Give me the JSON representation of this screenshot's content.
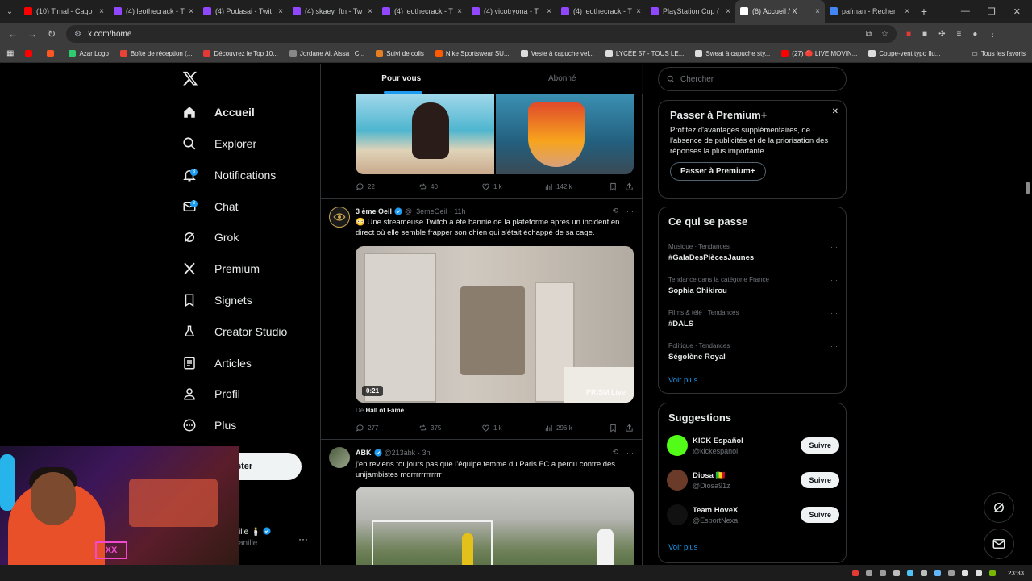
{
  "browser": {
    "tabs": [
      {
        "title": "(10) Timal - Cago",
        "color": "#ff0000"
      },
      {
        "title": "(4) leothecrack - T",
        "color": "#9146ff"
      },
      {
        "title": "(4) Podasai - Twit",
        "color": "#9146ff"
      },
      {
        "title": "(4) skaey_ftn - Tw",
        "color": "#9146ff"
      },
      {
        "title": "(4) leothecrack - T",
        "color": "#9146ff"
      },
      {
        "title": "(4) vicotryona - T",
        "color": "#9146ff"
      },
      {
        "title": "(4) leothecrack - T",
        "color": "#9146ff"
      },
      {
        "title": "PlayStation Cup (",
        "color": "#9146ff"
      },
      {
        "title": "(6) Accueil / X",
        "color": "#ffffff",
        "active": true
      },
      {
        "title": "pafman - Recher",
        "color": "#4285f4"
      }
    ],
    "url": "x.com/home",
    "bookmarks": [
      {
        "label": "",
        "color": "#ff0000"
      },
      {
        "label": "",
        "color": "#ff5722"
      },
      {
        "label": "Azar Logo",
        "color": "#2ecc71"
      },
      {
        "label": "Boîte de réception (...",
        "color": "#ea4335"
      },
      {
        "label": "Découvrez le Top 10...",
        "color": "#e53935"
      },
      {
        "label": "Jordane Ait Aissa | C...",
        "color": "#888888"
      },
      {
        "label": "Suivi de colis",
        "color": "#e67e22"
      },
      {
        "label": "Nike Sportswear SU...",
        "color": "#ff5a00"
      },
      {
        "label": "Veste à capuche vel...",
        "color": "#dddddd"
      },
      {
        "label": "LYCÉE 57 - TOUS LE...",
        "color": "#dddddd"
      },
      {
        "label": "Sweat à capuche sty...",
        "color": "#dddddd"
      },
      {
        "label": "(27) 🔴 LIVE MOVIN...",
        "color": "#ff0000"
      },
      {
        "label": "Coupe-vent typo flu...",
        "color": "#dddddd"
      }
    ],
    "all_bookmarks": "Tous les favoris",
    "clock": "23:33"
  },
  "nav": {
    "items": [
      {
        "label": "Accueil",
        "icon": "home-icon",
        "active": true
      },
      {
        "label": "Explorer",
        "icon": "search-icon"
      },
      {
        "label": "Notifications",
        "icon": "bell-icon",
        "badge": "3"
      },
      {
        "label": "Chat",
        "icon": "mail-icon",
        "badge": "3"
      },
      {
        "label": "Grok",
        "icon": "grok-icon"
      },
      {
        "label": "Premium",
        "icon": "x-premium-icon"
      },
      {
        "label": "Signets",
        "icon": "bookmark-icon"
      },
      {
        "label": "Creator Studio",
        "icon": "flask-icon"
      },
      {
        "label": "Articles",
        "icon": "article-icon"
      },
      {
        "label": "Profil",
        "icon": "person-icon"
      },
      {
        "label": "Plus",
        "icon": "more-circle-icon"
      }
    ],
    "post_button": "ster",
    "profile_name": "ille 🕯️",
    "profile_handle": "anille"
  },
  "feed": {
    "tabs": [
      "Pour vous",
      "Abonné"
    ],
    "post0": {
      "replies": "22",
      "reposts": "40",
      "likes": "1 k",
      "views": "142 k"
    },
    "post1": {
      "name": "3 ème Oeil",
      "handle": "@_3emeOeil",
      "time": "· 11h",
      "text": "😳 Une streameuse Twitch a été bannie de la plateforme après un incident en direct où elle semble frapper son chien qui s'était échappé de sa cage.",
      "duration": "0:21",
      "watermark": "PRISM Live",
      "from_prefix": "De",
      "from_source": "Hall of Fame",
      "replies": "277",
      "reposts": "375",
      "likes": "1 k",
      "views": "296 k"
    },
    "post2": {
      "name": "ABK",
      "handle": "@213abk",
      "time": "· 3h",
      "text": "j'en reviens toujours pas que l'équipe femme du Paris FC a perdu contre des unijambistes mdrrrrrrrrrrrr"
    }
  },
  "right": {
    "search_placeholder": "Chercher",
    "premium": {
      "title": "Passer à Premium+",
      "text": "Profitez d'avantages supplémentaires, de l'absence de publicités et de la priorisation des réponses la plus importante.",
      "button": "Passer à Premium+"
    },
    "trends": {
      "title": "Ce qui se passe",
      "items": [
        {
          "meta": "Musique · Tendances",
          "name": "#GalaDesPiècesJaunes"
        },
        {
          "meta": "Tendance dans la catégorie France",
          "name": "Sophia Chikirou"
        },
        {
          "meta": "Films & télé · Tendances",
          "name": "#DALS"
        },
        {
          "meta": "Politique · Tendances",
          "name": "Ségolène Royal"
        }
      ],
      "more": "Voir plus"
    },
    "suggestions": {
      "title": "Suggestions",
      "items": [
        {
          "name": "KICK Español",
          "handle": "@kickespanol",
          "color": "#53fc18"
        },
        {
          "name": "Diosa 🇲🇱",
          "handle": "@Diosa91z",
          "color": "#6b3b2a"
        },
        {
          "name": "Team HoveX",
          "handle": "@EsportNexa",
          "color": "#111111"
        }
      ],
      "follow": "Suivre",
      "more": "Voir plus"
    }
  },
  "webcam": {
    "sign": "XX"
  }
}
